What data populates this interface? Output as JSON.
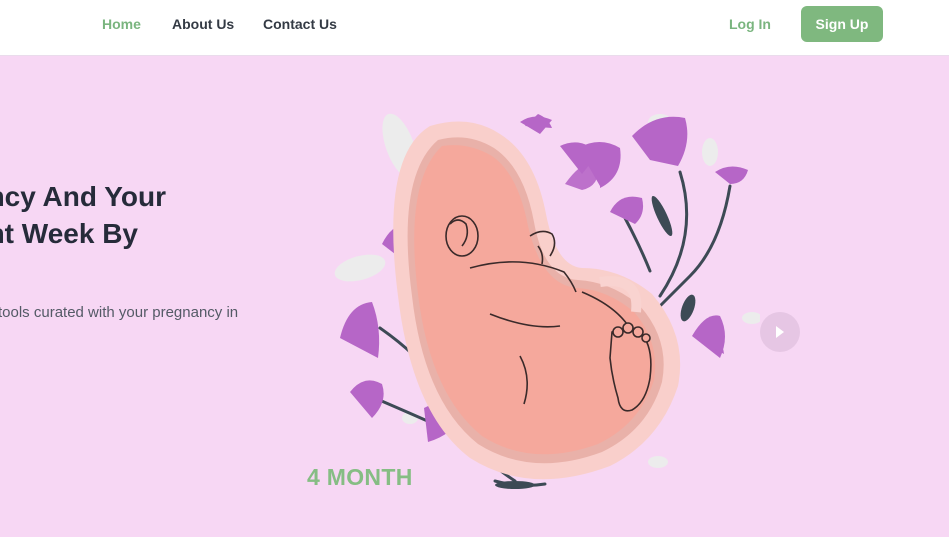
{
  "nav": {
    "home": "Home",
    "about": "About Us",
    "contact": "Contact Us",
    "login": "Log In",
    "signup": "Sign Up"
  },
  "hero": {
    "title_line1": "ancy And Your",
    "title_line2": "ent Week By",
    "subtitle": "tools curated with your pregnancy in"
  },
  "slider": {
    "month_label": "4 MONTH",
    "next_icon": "chevron-right-icon"
  },
  "colors": {
    "accent": "#7fb87f",
    "background": "#f7d7f4",
    "heading": "#262b3a",
    "flower": "#b666c7"
  }
}
